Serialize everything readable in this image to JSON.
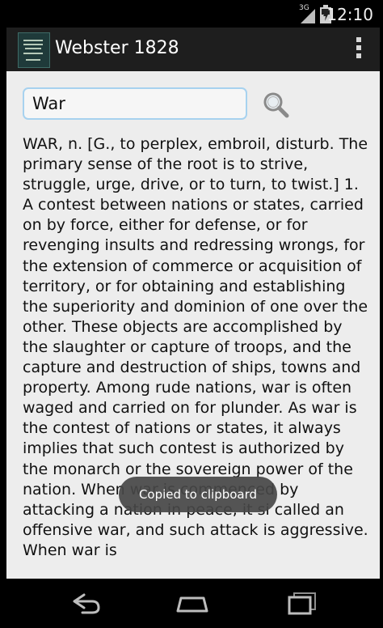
{
  "status_bar": {
    "network": "3G",
    "time": "12:10"
  },
  "action_bar": {
    "title": "Webster 1828",
    "icons": [
      "app-book-icon",
      "overflow-menu-icon"
    ]
  },
  "search": {
    "value": "War",
    "button_icon": "magnifier-icon"
  },
  "definition": {
    "text": "WAR, n. [G., to perplex, embroil, disturb. The primary sense of the root is to strive, struggle, urge, drive, or to turn, to twist.] 1. A contest between nations or states, carried on by force, either for defense, or for revenging insults and redressing wrongs, for the extension of commerce or acquisition of territory, or for obtaining and establishing the superiority and dominion of one over the other. These objects are accomplished by the slaughter or capture of troops, and the capture and destruction of ships, towns and property. Among rude nations, war is often waged and carried on for plunder. As war is the contest of nations or states, it always implies that such contest is authorized by the monarch or the sovereign power of the nation. When war is commenced by attacking a nation in peace, it si called an offensive war, and such attack is aggressive. When war is"
  },
  "toast": {
    "message": "Copied to clipboard"
  },
  "nav_bar": {
    "icons": [
      "back-icon",
      "home-icon",
      "recent-apps-icon"
    ]
  }
}
